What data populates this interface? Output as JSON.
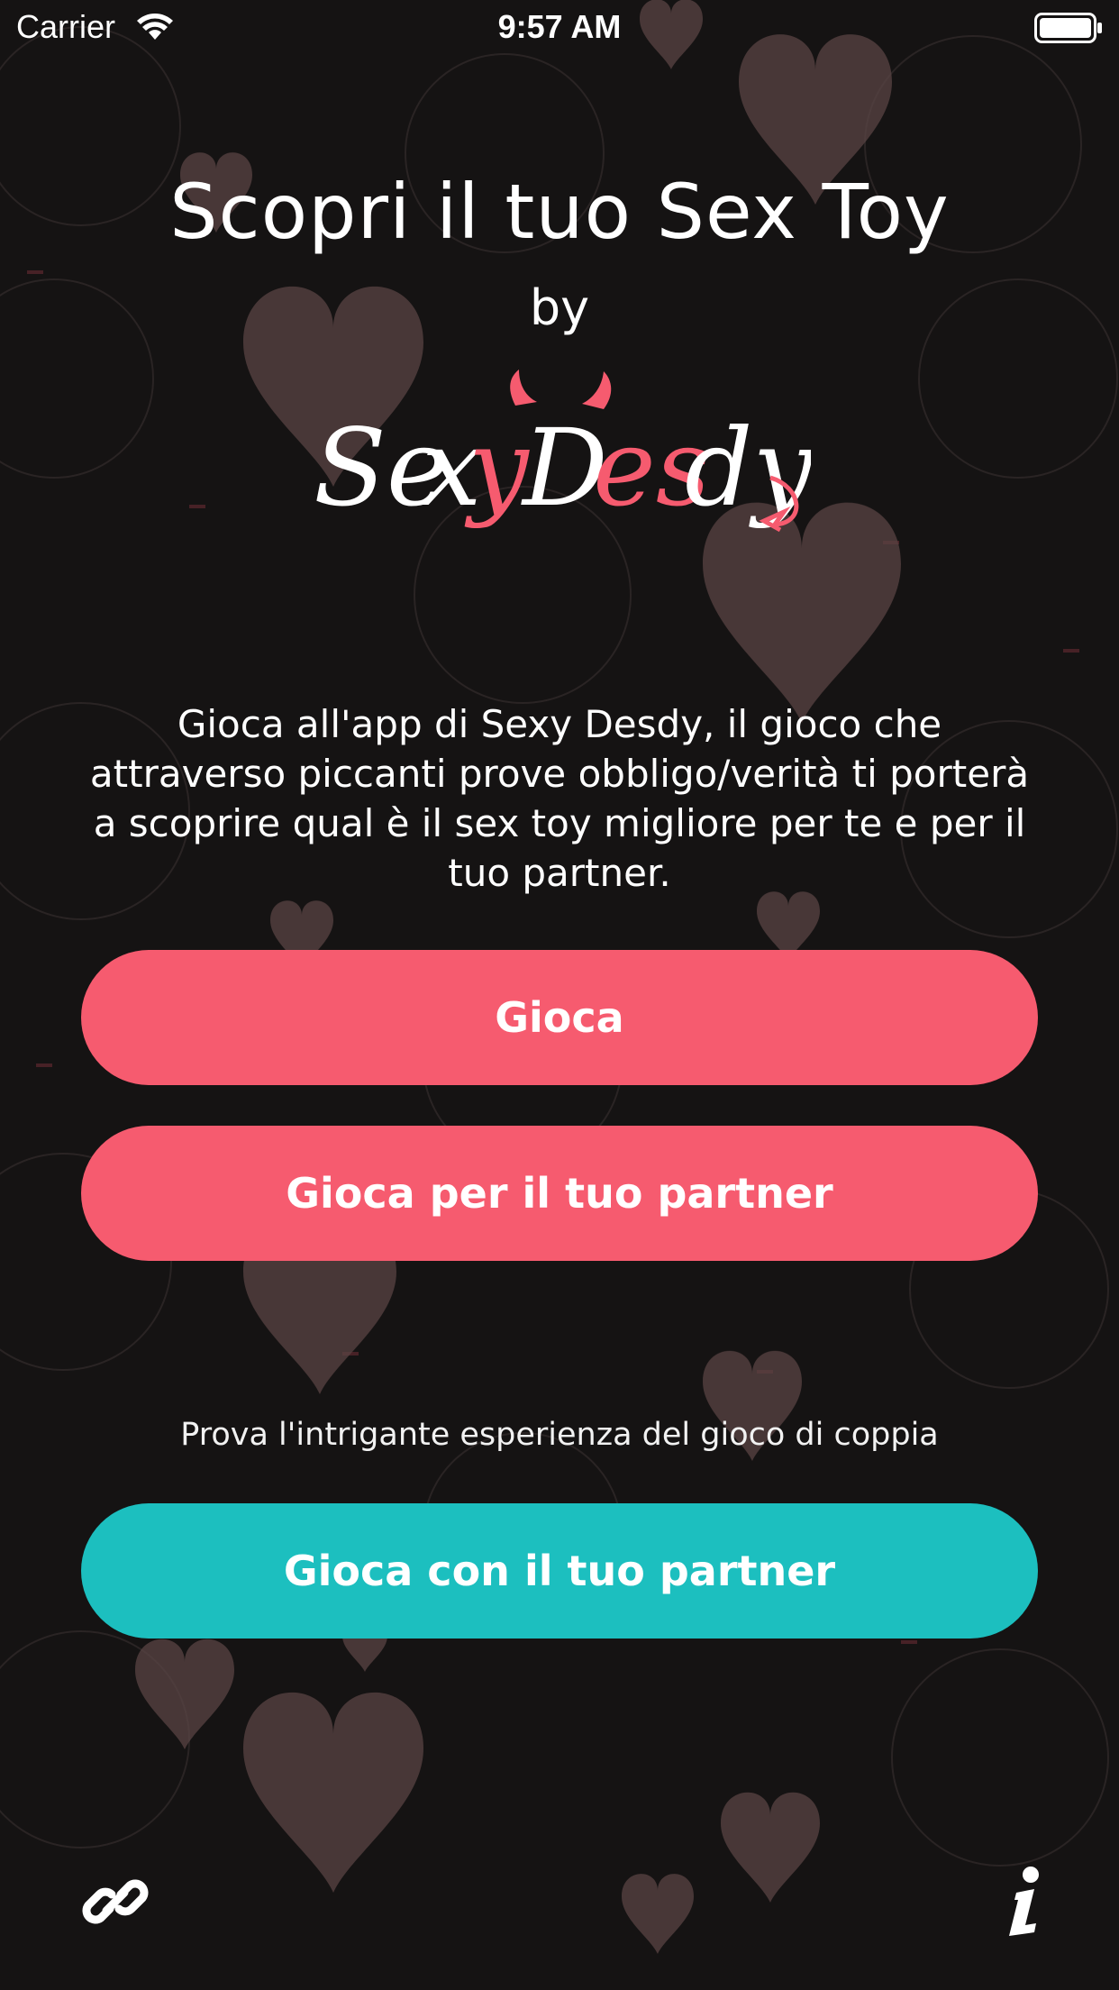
{
  "status_bar": {
    "carrier": "Carrier",
    "time": "9:57 AM",
    "wifi_icon": "wifi-icon",
    "battery_icon": "battery-icon"
  },
  "header": {
    "title": "Scopri il tuo Sex Toy",
    "by": "by",
    "logo_text": "SexyDesdy"
  },
  "main": {
    "description": "Gioca all'app di Sexy Desdy, il gioco che attraverso piccanti prove obbligo/verità ti porterà a scoprire qual è il sex toy migliore per te e per il tuo partner.",
    "play_button": "Gioca",
    "play_for_partner_button": "Gioca per il tuo partner",
    "couple_hint": "Prova l'intrigante esperienza del gioco di coppia",
    "play_with_partner_button": "Gioca con il tuo partner"
  },
  "footer": {
    "link_icon": "link-icon",
    "info_icon": "info-icon"
  },
  "colors": {
    "background": "#151313",
    "primary_button": "#f65b6f",
    "secondary_button": "#1cbfbf",
    "heart": "#5a4444",
    "logo_accent": "#f65b6f"
  }
}
